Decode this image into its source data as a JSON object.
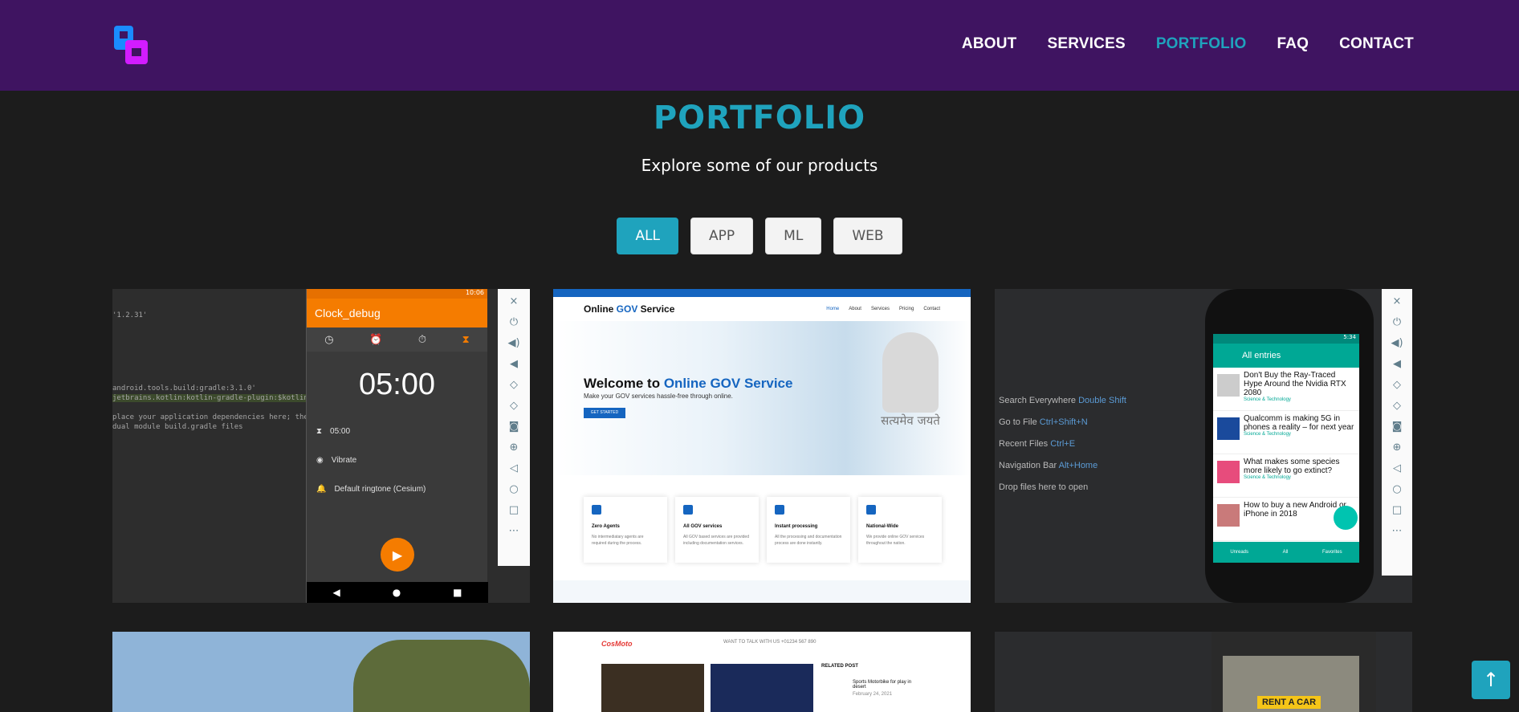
{
  "header": {
    "nav": [
      "ABOUT",
      "SERVICES",
      "PORTFOLIO",
      "FAQ",
      "CONTACT"
    ],
    "active": "PORTFOLIO"
  },
  "section": {
    "title": "PORTFOLIO",
    "subtitle": "Explore some of our products"
  },
  "filters": [
    "ALL",
    "APP",
    "ML",
    "WEB"
  ],
  "active_filter": "ALL",
  "card1": {
    "code_lines": [
      "'1.2.31'",
      "android.tools.build:gradle:3.1.0'",
      "jetbrains.kotlin:kotlin-gradle-plugin:$kotlin_version",
      "place your application dependencies here; they bel",
      "dual module build.gradle files"
    ],
    "status_time": "10:06",
    "app_title": "Clock_debug",
    "timer": "05:00",
    "rows": [
      "05:00",
      "Vibrate",
      "Default ringtone (Cesium)"
    ]
  },
  "card2": {
    "brand_prefix": "Online ",
    "brand_accent": "GOV",
    "brand_suffix": " Service",
    "menu": [
      "Home",
      "About",
      "Services",
      "Pricing",
      "Contact"
    ],
    "hero_prefix": "Welcome to ",
    "hero_accent": "Online GOV Service",
    "hero_sub": "Make your GOV services hassle-free through online.",
    "cta": "GET STARTED",
    "motto": "सत्यमेव जयते",
    "features": [
      {
        "title": "Zero Agents",
        "desc": "No intermediatary agents are required during the process."
      },
      {
        "title": "All GOV services",
        "desc": "All GOV based services are provided including documentation services."
      },
      {
        "title": "Instant processing",
        "desc": "All the processing and documentation process are done instantly."
      },
      {
        "title": "National-Wide",
        "desc": "We provide online GOV services throughout the nation."
      }
    ]
  },
  "card3": {
    "hints": [
      {
        "label": "Search Everywhere",
        "key": "Double Shift"
      },
      {
        "label": "Go to File",
        "key": "Ctrl+Shift+N"
      },
      {
        "label": "Recent Files",
        "key": "Ctrl+E"
      },
      {
        "label": "Navigation Bar",
        "key": "Alt+Home"
      },
      {
        "label": "Drop files here to open",
        "key": ""
      }
    ],
    "app_title": "All entries",
    "status_time": "5:34",
    "entries": [
      {
        "title": "Don't Buy the Ray-Traced Hype Around the Nvidia RTX 2080",
        "cat": "Science & Technology"
      },
      {
        "title": "Qualcomm is making 5G in phones a reality – for next year",
        "cat": "Science & Technology"
      },
      {
        "title": "What makes some species more likely to go extinct?",
        "cat": "Science & Technology"
      },
      {
        "title": "How to buy a new Android or iPhone in 2018",
        "cat": ""
      }
    ],
    "bottom_tabs": [
      "Unreads",
      "All",
      "Favorites"
    ]
  },
  "card5": {
    "logo": "CosMoto",
    "talk": "WANT TO TALK WITH US +01234 567 890",
    "related": "RELATED POST",
    "post_title": "Sports Motorbike for play in desert",
    "post_date": "February 24, 2021"
  },
  "card6": {
    "sign": "RENT A CAR"
  },
  "colors": {
    "header_bg": "#3f1461",
    "accent": "#1fa3bd",
    "page_bg": "#1c1c1c"
  }
}
